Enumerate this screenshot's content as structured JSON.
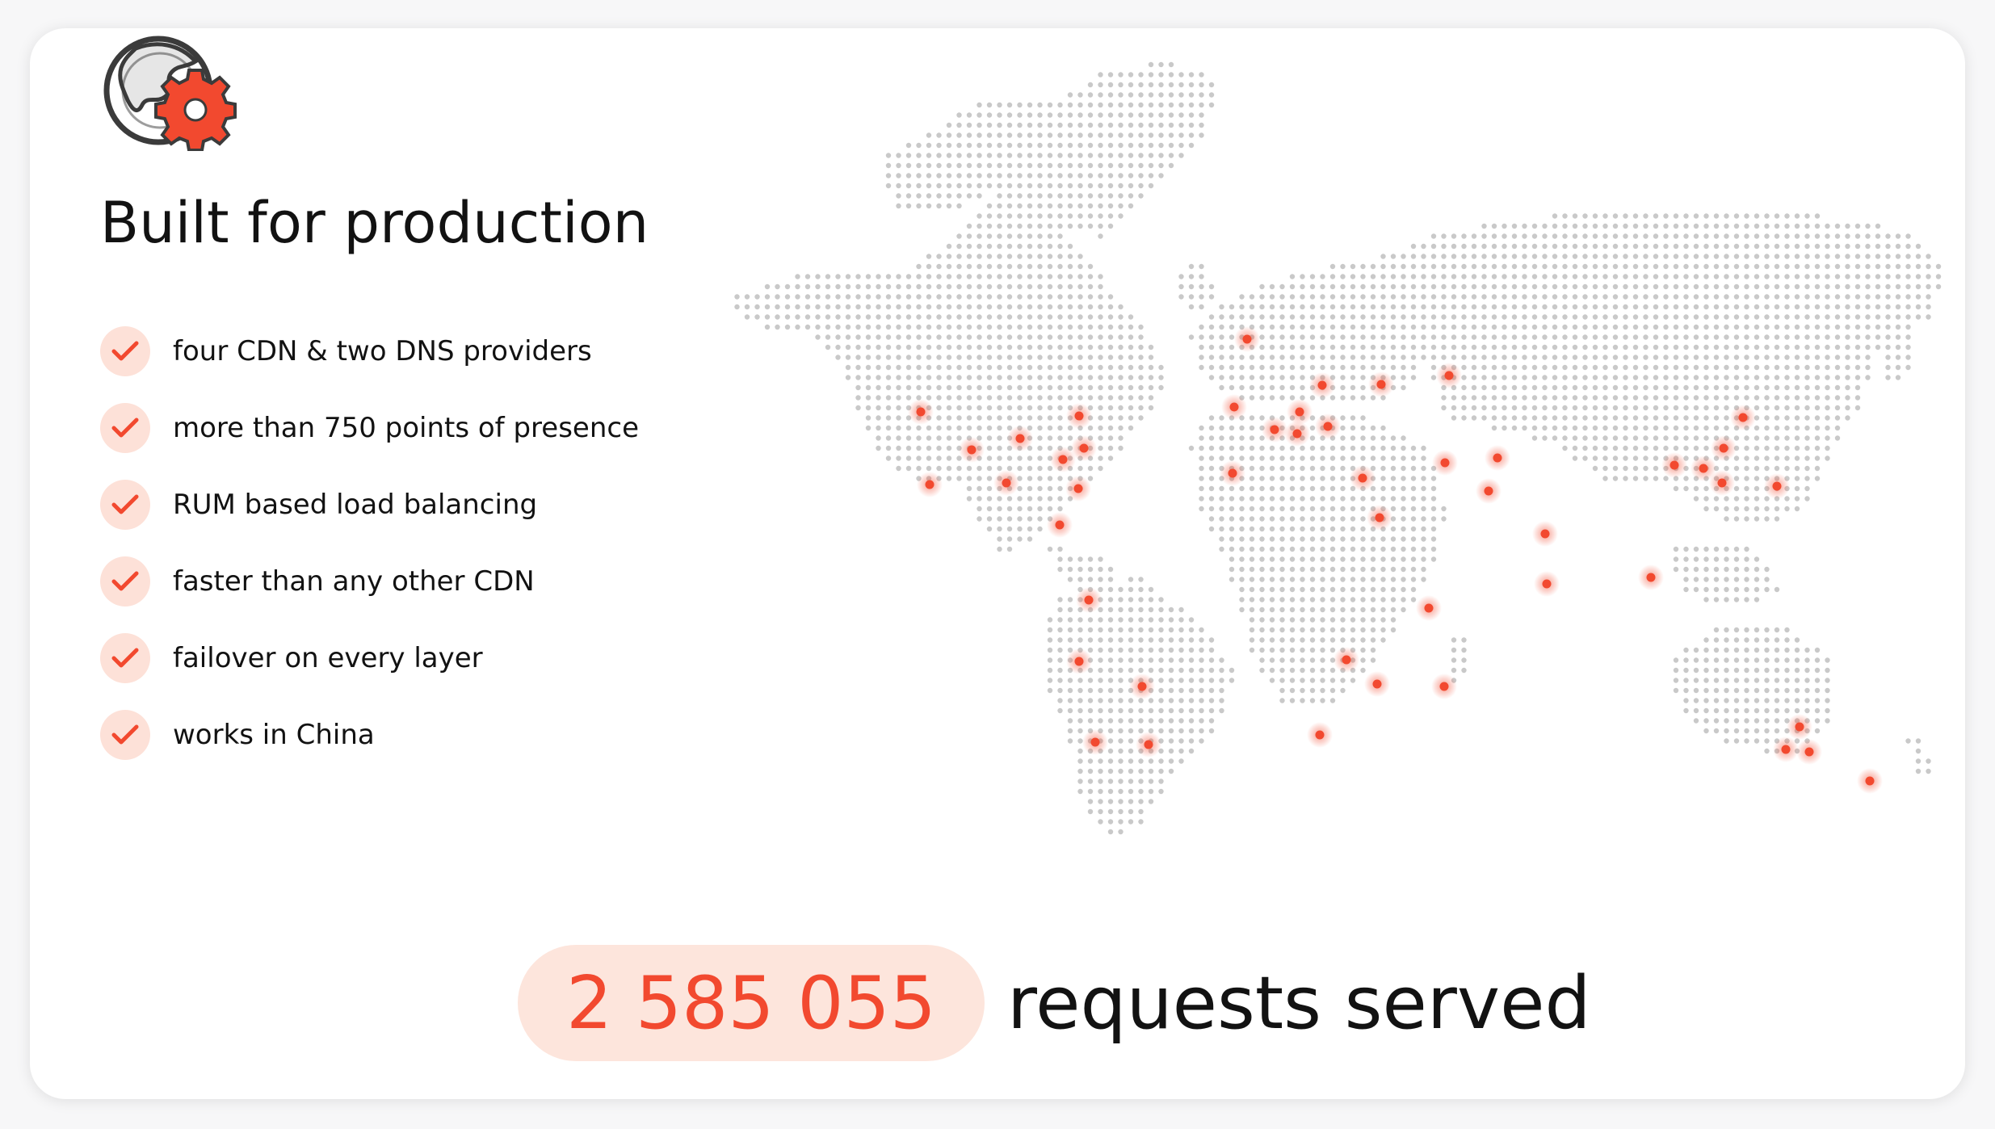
{
  "logo": {
    "icon": "globe-gear-icon",
    "brand_color": "#f2492f"
  },
  "heading": "Built for production",
  "features": [
    {
      "label": "four CDN & two DNS providers",
      "icon": "check-icon"
    },
    {
      "label": "more than 750 points of presence",
      "icon": "check-icon"
    },
    {
      "label": "RUM based load balancing",
      "icon": "check-icon"
    },
    {
      "label": "faster than any other CDN",
      "icon": "check-icon"
    },
    {
      "label": "failover on every layer",
      "icon": "check-icon"
    },
    {
      "label": "works in China",
      "icon": "check-icon"
    }
  ],
  "map": {
    "icon": "world-dot-map",
    "dot_color": "#c9c9c9",
    "pop_color": "#f2492f"
  },
  "counter": {
    "value": "2 585 055",
    "label": "requests served"
  },
  "colors": {
    "accent": "#f2492f",
    "accent_light": "#fde5dc",
    "text": "#121212"
  }
}
